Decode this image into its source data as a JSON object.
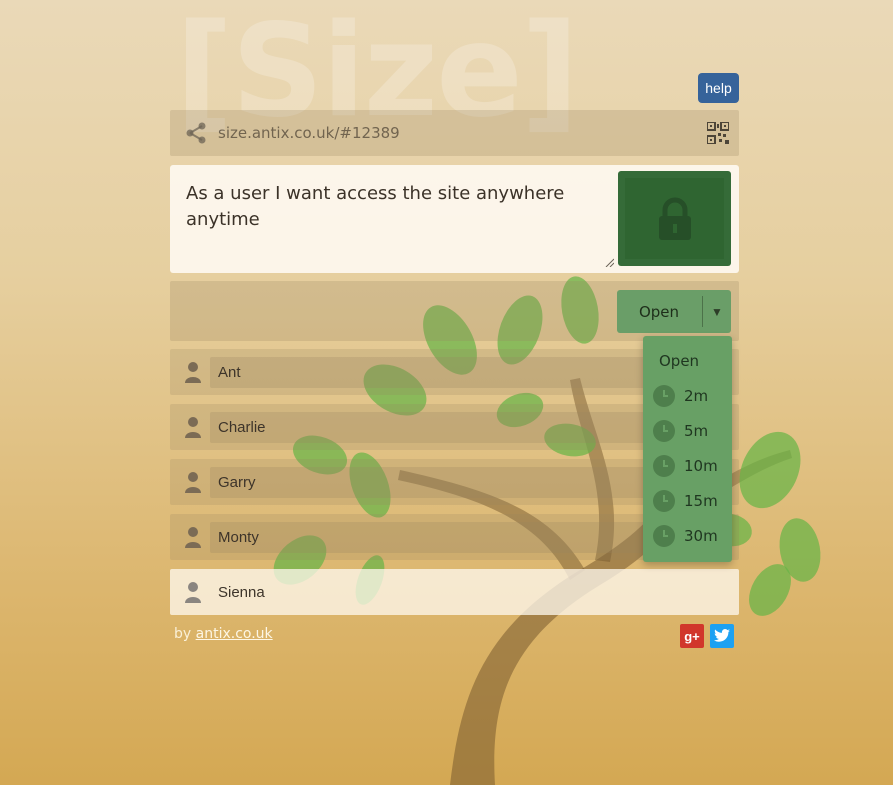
{
  "brand": {
    "watermark": "[Size]"
  },
  "header": {
    "help_label": "help"
  },
  "share": {
    "url": "size.antix.co.uk/#12389",
    "share_icon": "share-icon",
    "qr_icon": "qr-code-icon"
  },
  "story": {
    "text": "As a user I want access the site anywhere anytime",
    "lock_icon": "lock-icon"
  },
  "status": {
    "selected": "Open",
    "options": [
      {
        "label": "Open",
        "icon": ""
      },
      {
        "label": "2m",
        "icon": "clock-icon"
      },
      {
        "label": "5m",
        "icon": "clock-icon"
      },
      {
        "label": "10m",
        "icon": "clock-icon"
      },
      {
        "label": "15m",
        "icon": "clock-icon"
      },
      {
        "label": "30m",
        "icon": "clock-icon"
      }
    ]
  },
  "users": [
    {
      "name": "Ant",
      "active": false
    },
    {
      "name": "Charlie",
      "active": false
    },
    {
      "name": "Garry",
      "active": false
    },
    {
      "name": "Monty",
      "active": false
    },
    {
      "name": "Sienna",
      "active": true
    }
  ],
  "footer": {
    "by_prefix": "by",
    "link_text": "antix.co.uk",
    "gplus_label": "g+"
  },
  "colors": {
    "accent_green": "#68a065",
    "lock_green": "#356b38",
    "help_blue": "#36639a",
    "twitter_blue": "#1da1f2",
    "gplus_red": "#d1362b"
  }
}
